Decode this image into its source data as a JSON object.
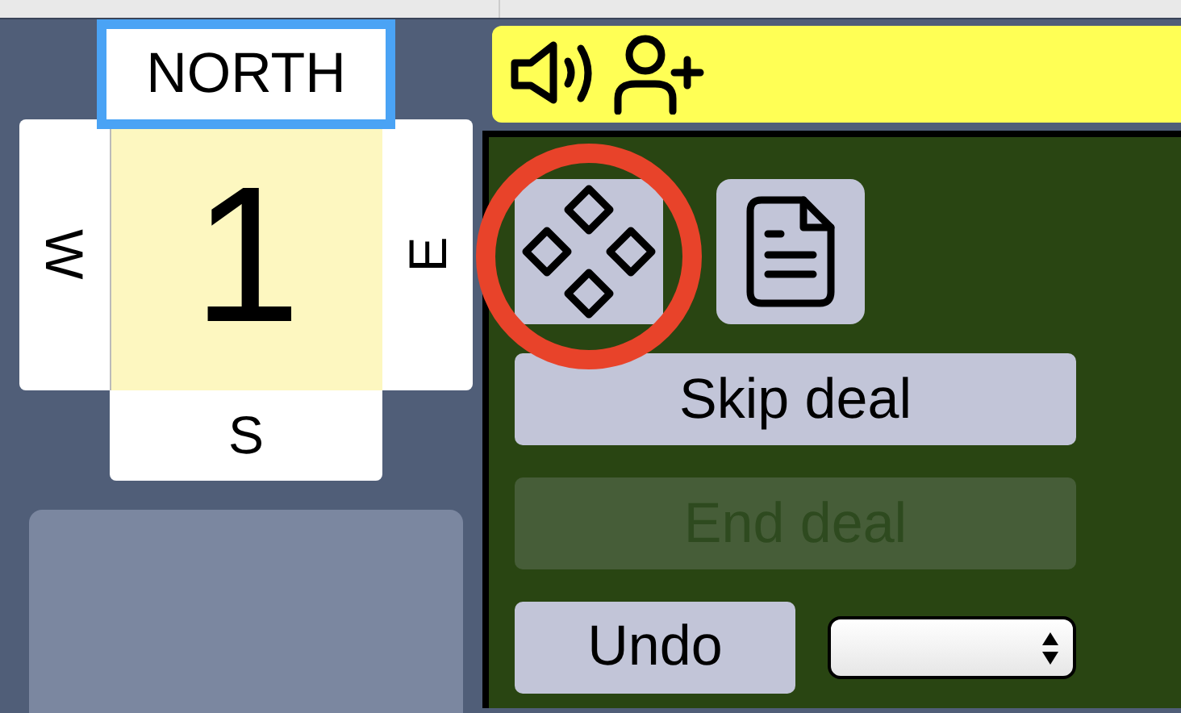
{
  "board": {
    "number": "1"
  },
  "seats": [
    {
      "kind": "north",
      "label": "NORTH",
      "selected": true
    },
    {
      "kind": "west",
      "label": "W",
      "selected": false
    },
    {
      "kind": "east",
      "label": "E",
      "selected": false
    },
    {
      "kind": "south",
      "label": "S",
      "selected": false
    }
  ],
  "toolbar": {
    "icons": [
      {
        "kind": "sound"
      },
      {
        "kind": "add-person"
      }
    ]
  },
  "tools": [
    {
      "kind": "grid",
      "highlighted": true
    },
    {
      "kind": "document",
      "highlighted": false
    }
  ],
  "actions": [
    {
      "label": "Skip deal",
      "disabled": false
    },
    {
      "label": "End deal",
      "disabled": true
    }
  ],
  "undo": {
    "label": "Undo"
  }
}
